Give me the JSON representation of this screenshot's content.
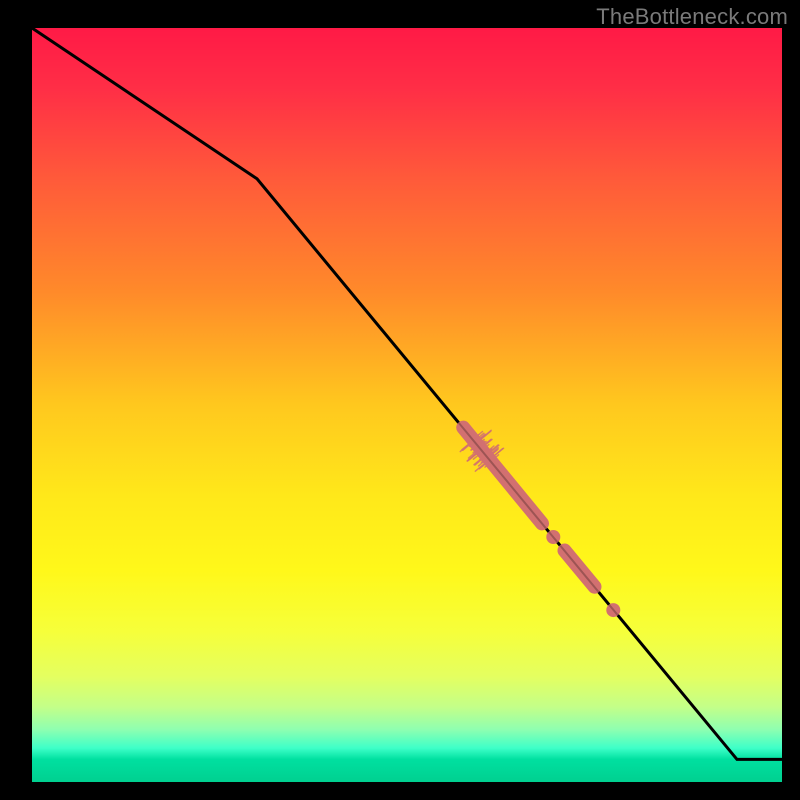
{
  "watermark": "TheBottleneck.com",
  "colors": {
    "gradient_stops": [
      {
        "offset": 0.0,
        "color": "#ff1a46"
      },
      {
        "offset": 0.08,
        "color": "#ff2e46"
      },
      {
        "offset": 0.2,
        "color": "#ff5a3a"
      },
      {
        "offset": 0.35,
        "color": "#ff8a2a"
      },
      {
        "offset": 0.5,
        "color": "#ffc81e"
      },
      {
        "offset": 0.62,
        "color": "#ffe81a"
      },
      {
        "offset": 0.72,
        "color": "#fff81a"
      },
      {
        "offset": 0.8,
        "color": "#f6ff3a"
      },
      {
        "offset": 0.86,
        "color": "#e4ff60"
      },
      {
        "offset": 0.9,
        "color": "#c4ff88"
      },
      {
        "offset": 0.93,
        "color": "#8fffb0"
      },
      {
        "offset": 0.955,
        "color": "#3effc8"
      },
      {
        "offset": 0.97,
        "color": "#00e0a0"
      },
      {
        "offset": 1.0,
        "color": "#00d090"
      }
    ],
    "line": "#000000",
    "marker": "#d27070",
    "background_frame": "#000000"
  },
  "chart_data": {
    "type": "line",
    "title": "",
    "xlabel": "",
    "ylabel": "",
    "xlim": [
      0,
      100
    ],
    "ylim": [
      0,
      100
    ],
    "grid": false,
    "legend": false,
    "series": [
      {
        "name": "curve",
        "x": [
          0,
          30,
          94,
          100
        ],
        "y": [
          100,
          80,
          3,
          3
        ]
      }
    ],
    "markers": {
      "thick_segments": [
        {
          "x0": 57.5,
          "y0": 47.0,
          "x1": 68.0,
          "y1": 34.3
        },
        {
          "x0": 71.0,
          "y0": 30.7,
          "x1": 75.0,
          "y1": 25.9
        }
      ],
      "dots": [
        {
          "x": 69.5,
          "y": 32.5
        },
        {
          "x": 77.5,
          "y": 22.8
        }
      ],
      "fringe_center": {
        "x": 59.5,
        "y": 44.6
      }
    }
  }
}
